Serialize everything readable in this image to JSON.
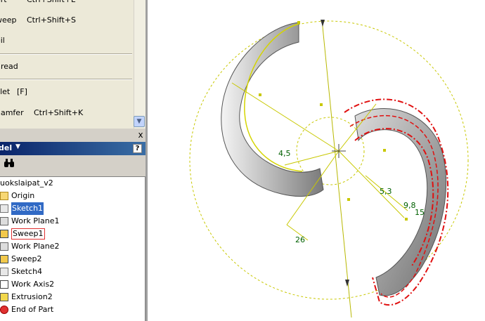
{
  "menu": {
    "items": [
      {
        "label": "ort",
        "shortcut": "Ctrl+Shift+L"
      },
      {
        "label": "weep",
        "shortcut": "Ctrl+Shift+S"
      },
      {
        "label": "oil",
        "shortcut": ""
      },
      {
        "label": "hread",
        "shortcut": ""
      },
      {
        "label": "illet",
        "shortcut": "[F]"
      },
      {
        "label": "hamfer",
        "shortcut": "Ctrl+Shift+K"
      }
    ],
    "scroll_down_icon": "chevron-down-icon",
    "close_icon": "x"
  },
  "browser": {
    "title": "del",
    "help_icon": "?",
    "find_icon": "binoculars-icon",
    "tree": [
      {
        "label": "uokslaipat_v2",
        "icon": "part-icon"
      },
      {
        "label": "Origin",
        "icon": "folder-icon"
      },
      {
        "label": "Sketch1",
        "icon": "sketch-icon"
      },
      {
        "label": "Work Plane1",
        "icon": "work-plane-icon"
      },
      {
        "label": "Sweep1",
        "icon": "sweep-icon"
      },
      {
        "label": "Work Plane2",
        "icon": "work-plane-icon"
      },
      {
        "label": "Sweep2",
        "icon": "sweep-icon"
      },
      {
        "label": "Sketch4",
        "icon": "sketch-icon"
      },
      {
        "label": "Work Axis2",
        "icon": "work-axis-icon"
      },
      {
        "label": "Extrusion2",
        "icon": "extrusion-icon"
      },
      {
        "label": "End of Part",
        "icon": "end-of-part-icon"
      }
    ]
  },
  "viewport": {
    "dimensions": [
      "4,5",
      "5,3",
      "9,8",
      "15",
      "26"
    ]
  },
  "colors": {
    "panel_bg": "#d4d0c8",
    "menu_bg": "#ece9d8",
    "header_blue": "#0a246a",
    "selection_blue": "#316ac5",
    "sketch_yellow": "#d4d400",
    "preview_red": "#e01010",
    "dimension_green": "#006000"
  }
}
